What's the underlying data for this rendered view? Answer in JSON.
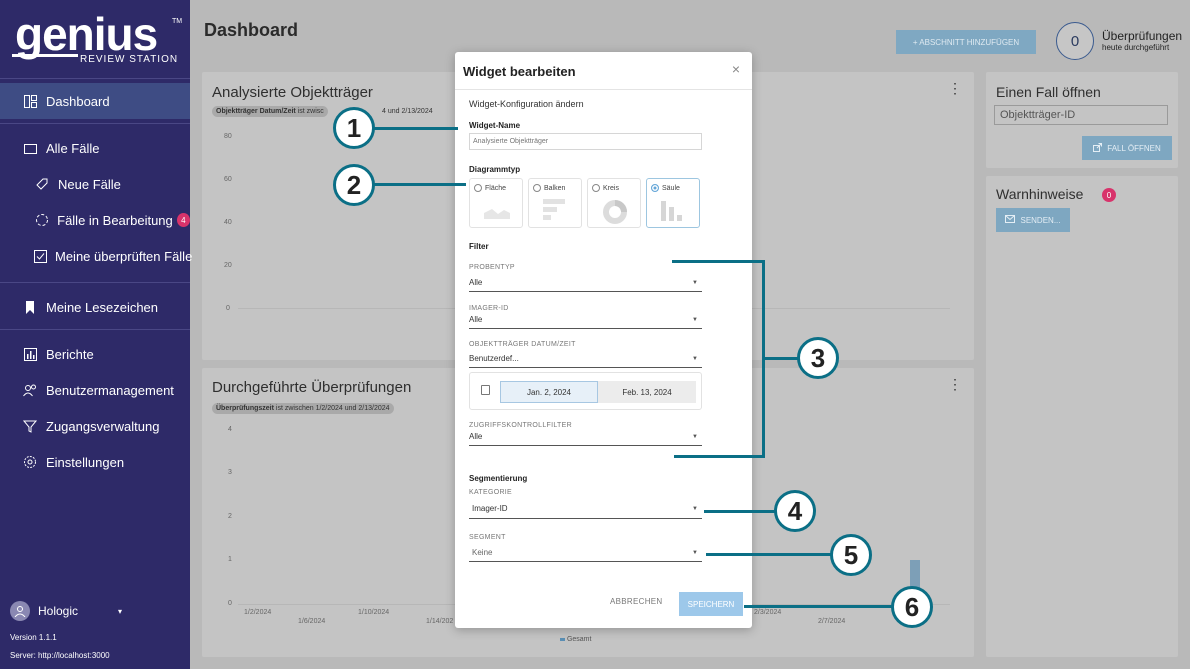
{
  "sidebar": {
    "logo": "genius",
    "logo_sub": "REVIEW STATION",
    "logo_tm": "TM",
    "items": [
      {
        "label": "Dashboard",
        "icon": "dashboard-icon"
      },
      {
        "label": "Alle Fälle",
        "icon": "folder-icon"
      },
      {
        "label": "Neue Fälle",
        "icon": "tag-icon"
      },
      {
        "label": "Fälle in Bearbeitung",
        "icon": "progress-icon",
        "badge": "4"
      },
      {
        "label": "Meine überprüften Fälle",
        "icon": "checkbox-icon"
      },
      {
        "label": "Meine Lesezeichen",
        "icon": "bookmark-icon"
      },
      {
        "label": "Berichte",
        "icon": "report-icon"
      },
      {
        "label": "Benutzermanagement",
        "icon": "users-icon"
      },
      {
        "label": "Zugangsverwaltung",
        "icon": "access-icon"
      },
      {
        "label": "Einstellungen",
        "icon": "gear-icon"
      }
    ],
    "user_name": "Hologic",
    "version": "Version 1.1.1",
    "server": "Server: http://localhost:3000"
  },
  "header": {
    "title": "Dashboard",
    "add_section": "+ ABSCHNITT HINZUFÜGEN",
    "review_count": "0",
    "review_label": "Überprüfungen",
    "review_sub": "heute durchgeführt"
  },
  "widget1": {
    "title": "Analysierte Objektträger",
    "chip_bold": "Objektträger Datum/Zeit",
    "chip_a": " ist zwisc",
    "chip_b": "4 und 2/13/2024",
    "y_ticks": [
      "80",
      "60",
      "40",
      "20",
      "0"
    ]
  },
  "widget2": {
    "title": "Durchgeführte Überprüfungen",
    "chip_bold": "Überprüfungszeit",
    "chip_rest": " ist zwischen 1/2/2024 und 2/13/2024",
    "y_ticks": [
      "4",
      "3",
      "2",
      "1",
      "0"
    ],
    "x_ticks": [
      "1/2/2024",
      "1/6/2024",
      "1/10/2024",
      "1/14/202",
      "2/3/2024",
      "2/7/2024"
    ],
    "legend": "Gesamt"
  },
  "open_case": {
    "title": "Einen Fall öffnen",
    "placeholder": "Objektträger-ID",
    "button": "FALL ÖFFNEN"
  },
  "warnings": {
    "title": "Warnhinweise",
    "count": "0",
    "button": "SENDEN..."
  },
  "modal": {
    "title": "Widget bearbeiten",
    "close": "×",
    "subtitle": "Widget-Konfiguration ändern",
    "name_label": "Widget-Name",
    "name_value": "Analysierte Objektträger",
    "chart_type_label": "Diagrammtyp",
    "chart_types": [
      "Fläche",
      "Balken",
      "Kreis",
      "Säule"
    ],
    "selected_chart_type": "Säule",
    "filter_label": "Filter",
    "probentyp_label": "PROBENTYP",
    "probentyp_value": "Alle",
    "imager_label": "IMAGER-ID",
    "imager_value": "Alle",
    "date_label": "OBJEKTTRÄGER DATUM/ZEIT",
    "date_value": "Benutzerdef...",
    "date_from": "Jan. 2, 2024",
    "date_to": "Feb. 13, 2024",
    "access_label": "ZUGRIFFSKONTROLLFILTER",
    "access_value": "Alle",
    "segment_title": "Segmentierung",
    "category_label": "KATEGORIE",
    "category_value": "Imager-ID",
    "segment_label": "SEGMENT",
    "segment_value": "Keine",
    "cancel": "ABBRECHEN",
    "save": "SPEICHERN"
  },
  "callouts": [
    "1",
    "2",
    "3",
    "4",
    "5",
    "6"
  ],
  "colors": {
    "sidebar": "#2e2a68",
    "active_nav": "#3e4c84",
    "badge": "#d8336b",
    "callout": "#0b6f86",
    "save_button": "#9dc8ea"
  }
}
